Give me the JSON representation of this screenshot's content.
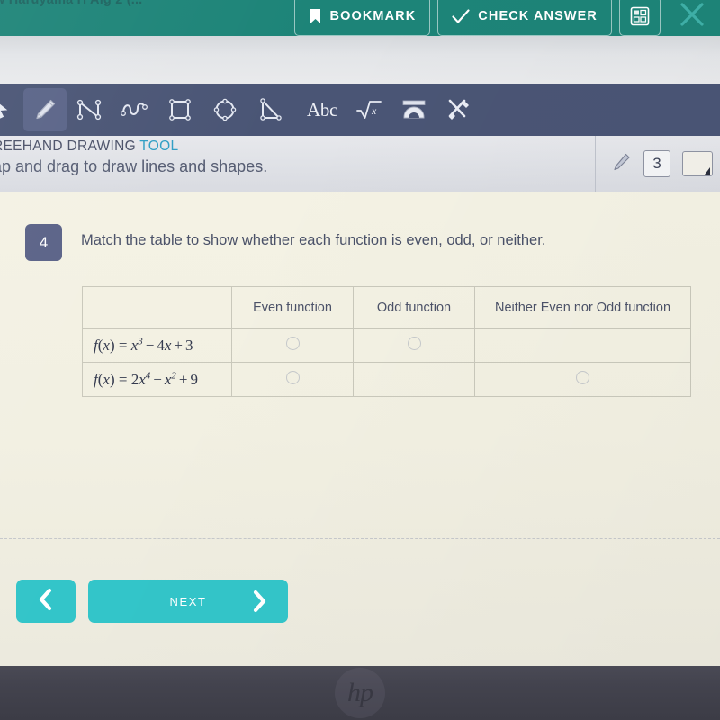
{
  "header": {
    "title": "w Haruyama H Alg 2 (...",
    "bookmark_label": "BOOKMARK",
    "check_answer_label": "CHECK ANSWER",
    "calculator_name": "calculator-icon",
    "close_name": "close-icon",
    "background_color": "#1d8478"
  },
  "toolbar": {
    "tools": [
      {
        "name": "select-cursor-tool",
        "label": "Select"
      },
      {
        "name": "freehand-pencil-tool",
        "label": "Freehand Drawing",
        "active": true
      },
      {
        "name": "polyline-tool",
        "label": "Polyline"
      },
      {
        "name": "curve-tool",
        "label": "Curve"
      },
      {
        "name": "rectangle-tool",
        "label": "Rectangle"
      },
      {
        "name": "polygon-tool",
        "label": "Polygon"
      },
      {
        "name": "triangle-tool",
        "label": "Triangle"
      },
      {
        "name": "text-tool",
        "label": "Abc"
      },
      {
        "name": "equation-tool",
        "label": "Equation"
      },
      {
        "name": "protractor-tool",
        "label": "Protractor"
      },
      {
        "name": "settings-wrench-tool",
        "label": "Tools"
      }
    ],
    "text_tool_glyph": "Abc",
    "background_color": "#4a5575"
  },
  "tool_info": {
    "name_prefix": "REEHAND DRAWING ",
    "name_accent": "TOOL",
    "hint": "ap and drag to draw lines and shapes.",
    "pencil_icon": "pencil-icon",
    "stroke_width": "3",
    "color_swatch": "#f3f1ea"
  },
  "question": {
    "number": "4",
    "prompt": "Match the table to show whether each function is even, odd, or neither.",
    "badge_color": "#5a6287"
  },
  "table": {
    "headers": [
      "",
      "Even function",
      "Odd function",
      "Neither Even nor Odd function"
    ],
    "rows": [
      {
        "function_label": "f(x) = x³ − 4x + 3",
        "function_parts": {
          "lhs": "f",
          "var": "x",
          "term1_base": "x",
          "term1_exp": "3",
          "term2": "4x",
          "term3": "3"
        },
        "options": [
          {
            "name": "radio-even-row1",
            "visible": true,
            "selected": false
          },
          {
            "name": "radio-odd-row1",
            "visible": true,
            "selected": false
          },
          {
            "name": "radio-neither-row1",
            "visible": false,
            "selected": false
          }
        ]
      },
      {
        "function_label": "f(x) = 2x⁴ − x² + 9",
        "function_parts": {
          "lhs": "f",
          "var": "x",
          "term1_coef": "2",
          "term1_base": "x",
          "term1_exp": "4",
          "term2_base": "x",
          "term2_exp": "2",
          "term3": "9"
        },
        "options": [
          {
            "name": "radio-even-row2",
            "visible": true,
            "selected": false
          },
          {
            "name": "radio-odd-row2",
            "visible": false,
            "selected": false
          },
          {
            "name": "radio-neither-row2",
            "visible": true,
            "selected": false
          }
        ]
      }
    ]
  },
  "nav": {
    "back_label": "",
    "back_icon": "chevron-left-icon",
    "next_label": "NEXT",
    "next_icon": "chevron-right-icon",
    "button_color": "#33c5c9"
  },
  "device": {
    "brand_logo": "hp"
  }
}
